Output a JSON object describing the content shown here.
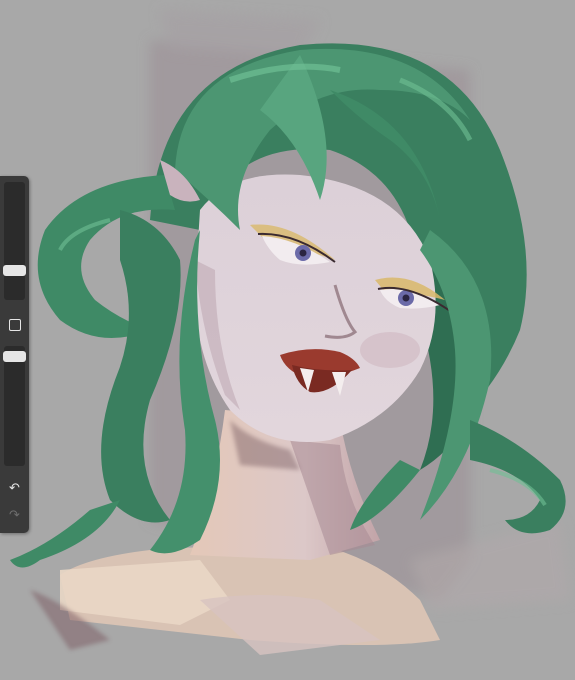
{
  "app": {
    "canvas_background": "#a8a8a8",
    "toolbar_background": "#3a3a3a"
  },
  "toolbar": {
    "brush_size_slider": {
      "icon": "slider-thumb",
      "level": 0.78
    },
    "modifier_button": {
      "icon": "square-outline-icon"
    },
    "opacity_slider": {
      "icon": "slider-thumb",
      "level": 0.95
    },
    "undo_button": {
      "icon": "undo-icon",
      "glyph": "↶"
    },
    "redo_button": {
      "icon": "redo-icon",
      "glyph": "↷",
      "enabled": false
    }
  },
  "artwork": {
    "subject": "painting",
    "hair_color": "#3f8a66",
    "skin_color": "#d9cfd6",
    "lip_color": "#9a3a2e"
  }
}
